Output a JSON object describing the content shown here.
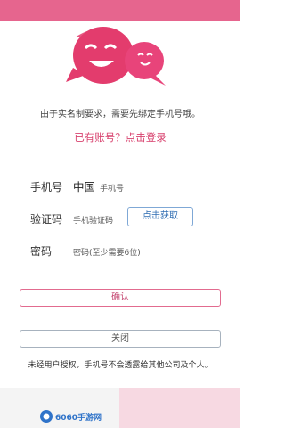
{
  "status_bar": {
    "left_text": "",
    "right_text": "",
    "color": "#e6658e"
  },
  "mascot": {
    "icon": "speech-bubble-faces-icon",
    "primary_color": "#e33c6d"
  },
  "notice": "由于实名制要求，需要先绑定手机号哦。",
  "login_link": "已有账号？点击登录",
  "form": {
    "phone": {
      "label": "手机号",
      "country": "中国",
      "placeholder": "手机号"
    },
    "code": {
      "label": "验证码",
      "placeholder": "手机验证码",
      "button": "点击获取"
    },
    "password": {
      "label": "密码",
      "placeholder": "密码(至少需要6位)"
    }
  },
  "buttons": {
    "confirm": "确认",
    "close": "关闭"
  },
  "privacy": "未经用户授权，手机号不会透露给其他公司及个人。",
  "watermark": "6060手游网"
}
